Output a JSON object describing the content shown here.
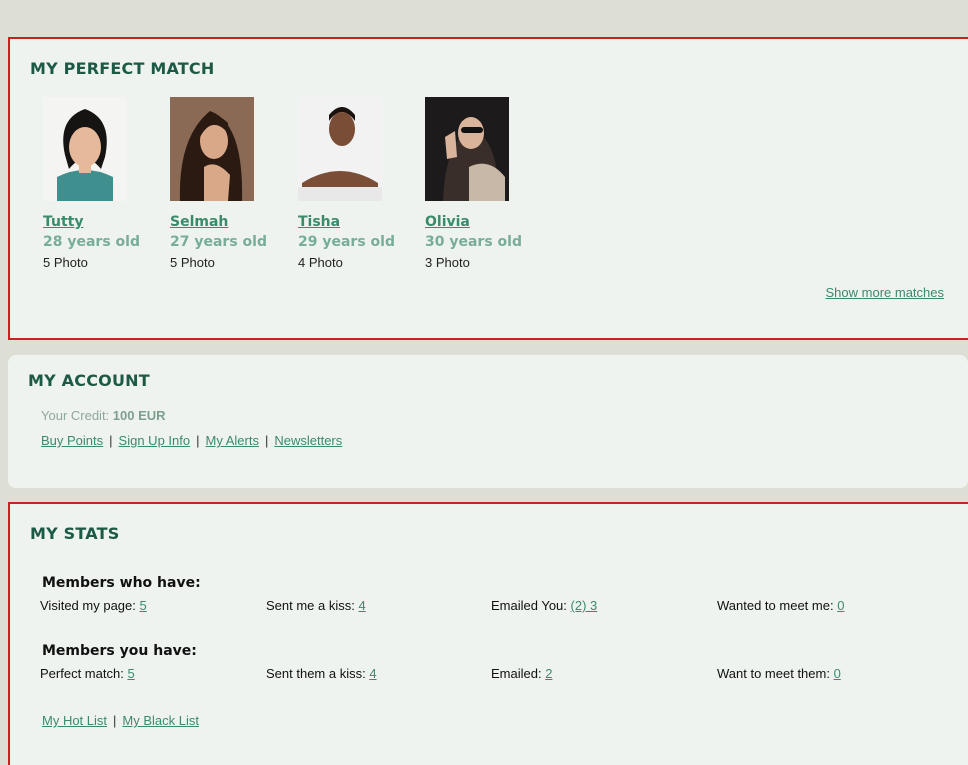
{
  "perfect_match": {
    "title": "MY PERFECT MATCH",
    "matches": [
      {
        "name": "Tutty",
        "age": "28 years old",
        "photos": "5 Photo"
      },
      {
        "name": "Selmah",
        "age": "27 years old",
        "photos": "5 Photo"
      },
      {
        "name": "Tisha",
        "age": "29 years old",
        "photos": "4 Photo"
      },
      {
        "name": "Olivia",
        "age": "30 years old",
        "photos": "3 Photo"
      }
    ],
    "show_more": "Show more matches"
  },
  "account": {
    "title": "MY ACCOUNT",
    "credit_label": "Your Credit:",
    "credit_value": "100 EUR",
    "links": [
      "Buy Points",
      "Sign Up Info",
      "My Alerts",
      "Newsletters"
    ],
    "separator": "|"
  },
  "stats": {
    "title": "MY STATS",
    "members_who_have": {
      "heading": "Members who have:",
      "items": [
        {
          "label": "Visited my page:",
          "value": "5"
        },
        {
          "label": "Sent me a kiss:",
          "value": "4"
        },
        {
          "label": "Emailed You:",
          "value": "(2) 3"
        },
        {
          "label": "Wanted to meet me:",
          "value": "0"
        }
      ]
    },
    "members_you_have": {
      "heading": "Members you have:",
      "items": [
        {
          "label": "Perfect match:",
          "value": "5"
        },
        {
          "label": "Sent them a kiss:",
          "value": "4"
        },
        {
          "label": "Emailed:",
          "value": "2"
        },
        {
          "label": "Want to meet them:",
          "value": "0"
        }
      ]
    },
    "hot_list": "My Hot List",
    "black_list": "My Black List",
    "separator": "|"
  },
  "colors": {
    "heading": "#1c5a45",
    "link": "#3b8a6c",
    "panel_bg": "#eef3ef",
    "page_bg": "#ddded4",
    "highlight_border": "#cc1f1f"
  }
}
